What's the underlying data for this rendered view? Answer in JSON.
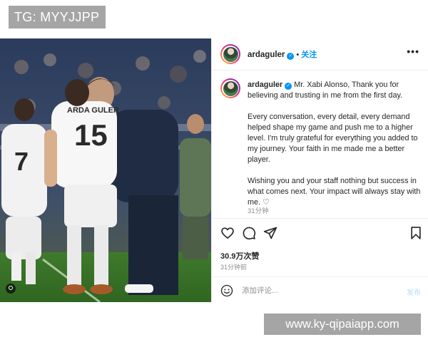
{
  "watermark_top": "TG: MYYJJPP",
  "watermark_bottom": "www.ky-qipaiapp.com",
  "post": {
    "username": "ardaguler",
    "verified_icon": "verified-badge-icon",
    "separator": "•",
    "follow_label": "关注",
    "more_icon": "more-options-icon",
    "more_label": "•••",
    "caption": {
      "username": "ardaguler",
      "para1": "Mr. Xabi Alonso, Thank you for believing and trusting in me from the first day.",
      "para2": "Every conversation, every detail, every demand helped shape my game and push me to a higher level. I'm truly grateful for everything you added to my journey. Your faith in me made me a better player.",
      "para3": "Wishing you and your staff nothing but success in what comes next. Your impact will always stay with me. ♡",
      "time": "31分钟"
    },
    "likes": "30.9万次赞",
    "time_ago": "31分钟前",
    "comment": {
      "placeholder": "添加评论...",
      "post_label": "发布"
    },
    "photo": {
      "player_front_name": "ARDA GULER",
      "player_front_number": "15",
      "player_back_number": "7"
    }
  },
  "colors": {
    "link_blue": "#0095f6",
    "muted_text": "#8e8e8e",
    "disabled_post": "#b2dffc",
    "watermark_bg": "#a5a5a5"
  }
}
